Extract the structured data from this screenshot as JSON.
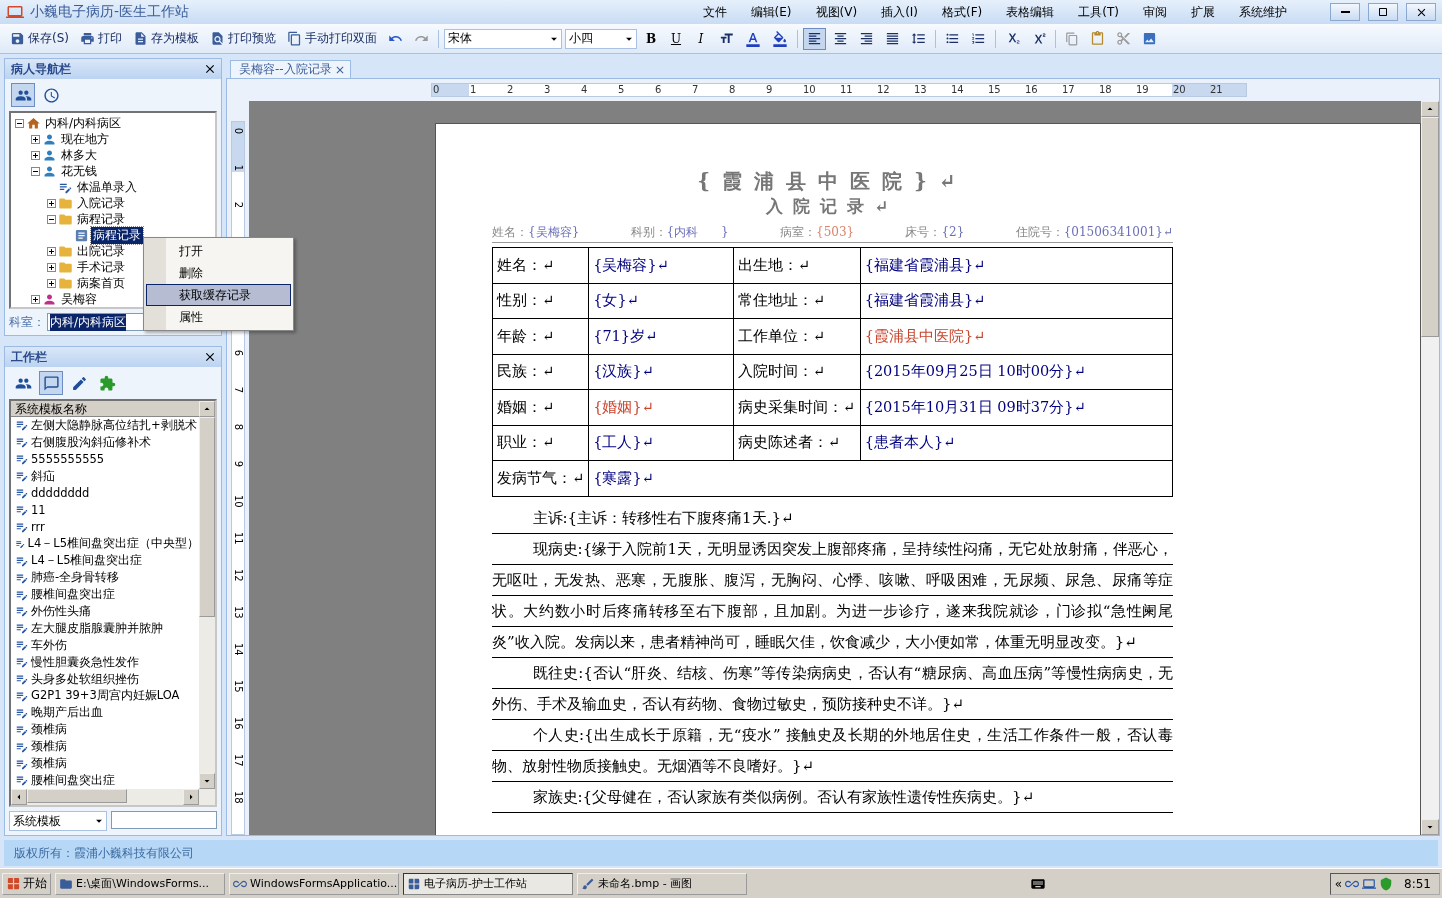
{
  "window": {
    "title": "小巍电子病历-医生工作站",
    "menu": [
      "文件",
      "编辑(E)",
      "视图(V)",
      "插入(I)",
      "格式(F)",
      "表格编辑",
      "工具(T)",
      "审阅",
      "扩展",
      "系统维护"
    ]
  },
  "toolbar": {
    "actions": [
      {
        "label": "保存(S)",
        "kind": "save"
      },
      {
        "label": "打印",
        "kind": "print"
      },
      {
        "label": "存为模板",
        "kind": "template"
      },
      {
        "label": "打印预览",
        "kind": "preview"
      },
      {
        "label": "手动打印双面",
        "kind": "duplex"
      }
    ],
    "font": "宋体",
    "size": "小四",
    "format": [
      {
        "label": "B",
        "kind": "bold"
      },
      {
        "label": "U",
        "kind": "underline"
      },
      {
        "label": "I",
        "kind": "italic"
      }
    ],
    "align": [
      {
        "kind": "left",
        "selected": true
      },
      {
        "kind": "center",
        "selected": false
      },
      {
        "kind": "right",
        "selected": false
      },
      {
        "kind": "justify",
        "selected": false
      },
      {
        "kind": "distribute",
        "selected": false
      }
    ]
  },
  "patient_nav": {
    "title": "病人导航栏",
    "tools": [
      {
        "kind": "patients",
        "selected": true
      },
      {
        "kind": "clock",
        "selected": false
      }
    ],
    "tree": [
      {
        "label": "内科/内科病区",
        "kind": "ward",
        "expanded": true,
        "selected": false,
        "children": [
          {
            "label": "现在地方",
            "kind": "patient",
            "expanded": false,
            "selected": false
          },
          {
            "label": "林多大",
            "kind": "patient",
            "expanded": false,
            "selected": false
          },
          {
            "label": "花无钱",
            "kind": "patient",
            "expanded": true,
            "selected": false,
            "children": [
              {
                "label": "体温单录入",
                "kind": "form",
                "selected": false
              },
              {
                "label": "入院记录",
                "kind": "folder",
                "expanded": false,
                "selected": false
              },
              {
                "label": "病程记录",
                "kind": "folder",
                "expanded": true,
                "selected": false,
                "children": [
                  {
                    "label": "病程记录",
                    "kind": "record",
                    "selected": true
                  }
                ]
              },
              {
                "label": "出院记录",
                "kind": "folder",
                "expanded": false,
                "selected": false
              },
              {
                "label": "手术记录",
                "kind": "folder",
                "expanded": false,
                "selected": false
              },
              {
                "label": "病案首页",
                "kind": "folder",
                "expanded": false,
                "selected": false
              }
            ]
          },
          {
            "label": "吴梅容",
            "kind": "patient_female",
            "expanded": false,
            "selected": false
          }
        ]
      }
    ],
    "dept": {
      "label": "科室：",
      "value": "内科/内科病区"
    }
  },
  "context_menu": [
    {
      "label": "打开",
      "selected": false
    },
    {
      "label": "删除",
      "selected": false
    },
    {
      "label": "获取缓存记录",
      "selected": true
    },
    {
      "label": "属性",
      "selected": false
    }
  ],
  "work_bar": {
    "title": "工作栏",
    "tools": [
      {
        "kind": "users",
        "selected": false
      },
      {
        "kind": "chat",
        "selected": true
      },
      {
        "kind": "edit",
        "selected": false
      },
      {
        "kind": "plugin",
        "selected": false
      }
    ],
    "list_header": "系统模板名称",
    "templates": [
      "左侧大隐静脉高位结扎+剥脱术",
      "右侧腹股沟斜疝修补术",
      "5555555555",
      "斜疝",
      "dddddddd",
      "11",
      "rrr",
      "L4－L5椎间盘突出症（中央型）",
      "L4－L5椎间盘突出症",
      "肺癌-全身骨转移",
      "腰椎间盘突出症",
      "外伤性头痛",
      "左大腿皮脂腺囊肿并脓肿",
      "车外伤",
      "慢性胆囊炎急性发作",
      "头身多处软组织挫伤",
      "G2P1 39+3周宫内妊娠LOA",
      "晚期产后出血",
      "颈椎病",
      "颈椎病",
      "颈椎病",
      "腰椎间盘突出症"
    ],
    "source": "系统模板"
  },
  "editor": {
    "tab": "吴梅容--入院记录",
    "ruler_h": [
      "0",
      "1",
      "2",
      "3",
      "4",
      "5",
      "6",
      "7",
      "8",
      "9",
      "10",
      "11",
      "12",
      "13",
      "14",
      "15",
      "16",
      "17",
      "18",
      "19",
      "20",
      "21"
    ],
    "ruler_v": [
      "0",
      "1",
      "2",
      "6",
      "7",
      "8",
      "9",
      "10",
      "11",
      "12",
      "13",
      "14",
      "15",
      "16",
      "17",
      "18"
    ]
  },
  "document": {
    "hospital": "{霞浦县中医院}↵",
    "title": "入院记录↵",
    "header_fields": [
      {
        "label": "姓名：",
        "value": "{吴梅容}",
        "color": "#6b6fb8"
      },
      {
        "label": "科别：",
        "value": "{内科      }",
        "color": "#6b6fb8"
      },
      {
        "label": "病室：",
        "value": "{503}",
        "color": "#d9826a"
      },
      {
        "label": "床号：",
        "value": "{2}",
        "color": "#6b6fb8"
      },
      {
        "label": "住院号：",
        "value": "{01506341001}↵",
        "color": "#6b6fb8"
      }
    ],
    "table": [
      {
        "cells": [
          {
            "text": "姓名：↵",
            "kind": "label"
          },
          {
            "text": "{吴梅容}↵",
            "kind": "value",
            "color": "#000080"
          },
          {
            "text": "出生地：↵",
            "kind": "label"
          },
          {
            "text": "{福建省霞浦县}↵",
            "kind": "value",
            "color": "#000080"
          }
        ]
      },
      {
        "cells": [
          {
            "text": "性别：↵",
            "kind": "label"
          },
          {
            "text": "{女}↵",
            "kind": "value",
            "color": "#000080"
          },
          {
            "text": "常住地址：↵",
            "kind": "label"
          },
          {
            "text": "{福建省霞浦县}↵",
            "kind": "value",
            "color": "#000080"
          }
        ]
      },
      {
        "cells": [
          {
            "text": "年龄：↵",
            "kind": "label"
          },
          {
            "text": "{71}岁↵",
            "kind": "value",
            "color": "#000080"
          },
          {
            "text": "工作单位：↵",
            "kind": "label"
          },
          {
            "text": "{霞浦县中医院}↵",
            "kind": "value",
            "color": "#c8452e"
          }
        ]
      },
      {
        "cells": [
          {
            "text": "民族：↵",
            "kind": "label"
          },
          {
            "text": "{汉族}↵",
            "kind": "value",
            "color": "#000080"
          },
          {
            "text": "入院时间：↵",
            "kind": "label"
          },
          {
            "text": "{2015年09月25日 10时00分}↵",
            "kind": "value",
            "color": "#000080"
          }
        ]
      },
      {
        "cells": [
          {
            "text": "婚姻：↵",
            "kind": "label"
          },
          {
            "text": "{婚姻}↵",
            "kind": "value",
            "color": "#c8452e"
          },
          {
            "text": "病史采集时间：↵",
            "kind": "label"
          },
          {
            "text": "{2015年10月31日 09时37分}↵",
            "kind": "value",
            "color": "#000080"
          }
        ]
      },
      {
        "cells": [
          {
            "text": "职业：↵",
            "kind": "label"
          },
          {
            "text": "{工人}↵",
            "kind": "value",
            "color": "#000080"
          },
          {
            "text": "病史陈述者：↵",
            "kind": "label"
          },
          {
            "text": "{患者本人}↵",
            "kind": "value",
            "color": "#000080"
          }
        ]
      },
      {
        "cells": [
          {
            "text": "发病节气：↵",
            "kind": "label"
          },
          {
            "text": "{寒露}↵",
            "kind": "value",
            "color": "#000080"
          }
        ]
      }
    ],
    "paragraphs": [
      "主诉:{主诉：转移性右下腹疼痛1天.}↵",
      "现病史:{缘于入院前1天，无明显诱因突发上腹部疼痛，呈持续性闷痛，无它处放射痛，伴恶心，无呕吐，无发热、恶寒，无腹胀、腹泻，无胸闷、心悸、咳嗽、呼吸困难，无尿频、尿急、尿痛等症状。大约数小时后疼痛转移至右下腹部，且加剧。为进一步诊疗，遂来我院就诊，门诊拟“急性阑尾炎”收入院。发病以来，患者精神尚可，睡眠欠佳，饮食减少，大小便如常，体重无明显改变。}↵",
      "既往史:{否认“肝炎、结核、伤寒”等传染病病史，否认有“糖尿病、高血压病”等慢性病病史，无外伤、手术及输血史，否认有药物、食物过敏史，预防接种史不详。}↵",
      "个人史:{出生成长于原籍，无“疫水” 接触史及长期的外地居住史，生活工作条件一般，否认毒物、放射性物质接触史。无烟酒等不良嗜好。}↵",
      "家族史:{父母健在，否认家族有类似病例。否认有家族性遗传性疾病史。}↵"
    ]
  },
  "status_bar": "版权所有：霞浦小巍科技有限公司",
  "taskbar": {
    "start": "开始",
    "tasks": [
      {
        "label": "E:\\桌面\\WindowsForms...",
        "kind": "folder",
        "selected": false
      },
      {
        "label": "WindowsFormsApplicatio...",
        "kind": "app",
        "selected": false
      },
      {
        "label": "电子病历-护士工作站",
        "kind": "window",
        "selected": true
      },
      {
        "label": "未命名.bmp - 画图",
        "kind": "paint",
        "selected": false
      }
    ],
    "tray_toggle": "«",
    "clock": "8:51"
  }
}
